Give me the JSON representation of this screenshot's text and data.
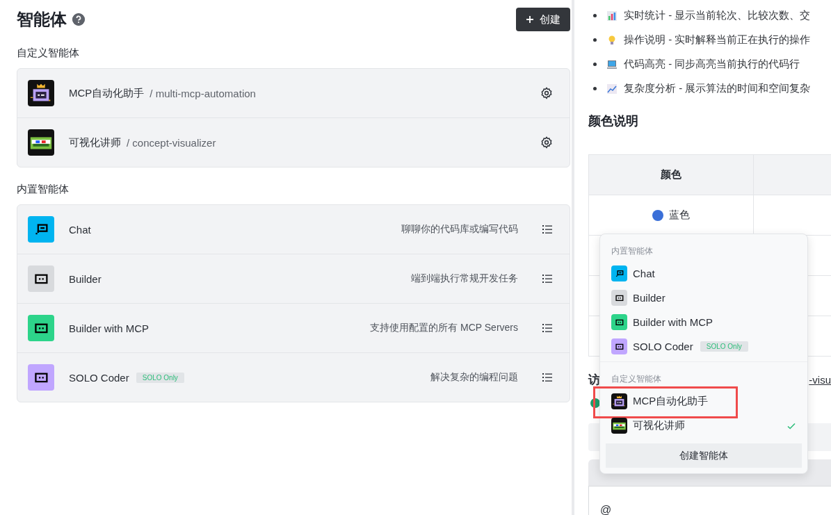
{
  "page": {
    "title": "智能体",
    "create_button": "创建",
    "custom_section": "自定义智能体",
    "builtin_section": "内置智能体"
  },
  "custom_agents": [
    {
      "name": "MCP自动化助手",
      "slug": "/ multi-mcp-automation",
      "kind": "crown"
    },
    {
      "name": "可视化讲师",
      "slug": "/ concept-visualizer",
      "kind": "glasses"
    }
  ],
  "builtin_agents": [
    {
      "name": "Chat",
      "description": "聊聊你的代码库或编写代码",
      "kind": "chat",
      "color": "#00b4f0"
    },
    {
      "name": "Builder",
      "description": "端到端执行常规开发任务",
      "kind": "dots",
      "color": "#d8dadd"
    },
    {
      "name": "Builder with MCP",
      "description": "支持使用配置的所有 MCP Servers",
      "kind": "dots",
      "color": "#2dd48a"
    },
    {
      "name": "SOLO Coder",
      "badge": "SOLO Only",
      "description": "解决复杂的编程问题",
      "kind": "dots",
      "color": "#c0a6ff"
    }
  ],
  "document": {
    "bullets": [
      {
        "kind": "bar-chart",
        "text": "实时统计 - 显示当前轮次、比较次数、交"
      },
      {
        "kind": "lightbulb",
        "text": "操作说明 - 实时解释当前正在执行的操作"
      },
      {
        "kind": "laptop",
        "text": "代码高亮 - 同步高亮当前执行的代码行"
      },
      {
        "kind": "line-chart",
        "text": "复杂度分析 - 展示算法的时间和空间复杂"
      }
    ],
    "heading": "颜色说明",
    "table": {
      "columns": [
        "颜色"
      ],
      "rows": [
        {
          "color": "#3a6fd8",
          "label": "蓝色"
        }
      ]
    },
    "partial_heading": "访",
    "link": "-visu"
  },
  "input": {
    "value": "@"
  },
  "popup": {
    "sections": [
      {
        "title": "内置智能体",
        "items": [
          {
            "name": "Chat",
            "kind": "chat",
            "color": "#00b4f0",
            "selected": false,
            "annotated": false
          },
          {
            "name": "Builder",
            "kind": "dots",
            "color": "#d8dadd",
            "selected": false,
            "annotated": false
          },
          {
            "name": "Builder with MCP",
            "kind": "dots",
            "color": "#2dd48a",
            "selected": false,
            "annotated": false
          },
          {
            "name": "SOLO Coder",
            "kind": "dots",
            "color": "#c0a6ff",
            "badge": "SOLO Only",
            "selected": false,
            "annotated": false
          }
        ]
      },
      {
        "title": "自定义智能体",
        "items": [
          {
            "name": "MCP自动化助手",
            "kind": "crown",
            "selected": false,
            "annotated": true
          },
          {
            "name": "可视化讲师",
            "kind": "glasses",
            "selected": true,
            "annotated": false
          }
        ]
      }
    ],
    "footer_button": "创建智能体"
  }
}
